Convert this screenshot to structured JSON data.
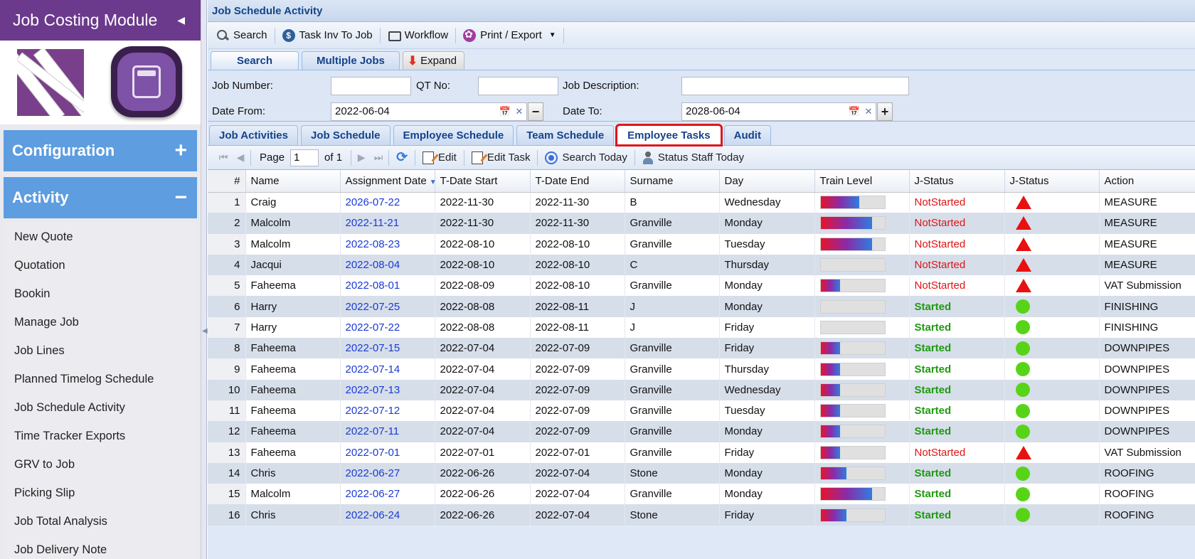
{
  "sidebar": {
    "title": "Job Costing Module",
    "sections": [
      {
        "label": "Configuration",
        "sign": "+"
      },
      {
        "label": "Activity",
        "sign": "−"
      }
    ],
    "menu": [
      "New Quote",
      "Quotation",
      "Bookin",
      "Manage Job",
      "Job Lines",
      "Planned Timelog Schedule",
      "Job Schedule Activity",
      "Time Tracker Exports",
      "GRV to Job",
      "Picking Slip",
      "Job Total Analysis",
      "Job Delivery Note"
    ]
  },
  "panel_title": "Job Schedule Activity",
  "toolbar": {
    "search": "Search",
    "task_inv": "Task Inv To Job",
    "workflow": "Workflow",
    "print_export": "Print / Export"
  },
  "search_tabs": {
    "search": "Search",
    "multiple": "Multiple Jobs",
    "expand": "Expand"
  },
  "form": {
    "job_number_label": "Job Number:",
    "qt_no_label": "QT No:",
    "job_desc_label": "Job Description:",
    "date_from_label": "Date From:",
    "date_from": "2022-06-04",
    "date_to_label": "Date To:",
    "date_to": "2028-06-04"
  },
  "tabs": [
    "Job Activities",
    "Job Schedule",
    "Employee Schedule",
    "Team Schedule",
    "Employee Tasks",
    "Audit"
  ],
  "active_tab": "Employee Tasks",
  "pager": {
    "page_label": "Page",
    "page": "1",
    "of": "of 1",
    "edit": "Edit",
    "edit_task": "Edit Task",
    "search_today": "Search Today",
    "status_staff": "Status Staff Today"
  },
  "columns": [
    "#",
    "Name",
    "Assignment Date",
    "T-Date Start",
    "T-Date End",
    "Surname",
    "Day",
    "Train Level",
    "J-Status",
    "J-Status",
    "Action"
  ],
  "colors": {
    "not_started": "#e01414",
    "started": "#1e9a10",
    "accent": "#15428b"
  },
  "rows": [
    {
      "n": "1",
      "name": "Craig",
      "assign": "2026-07-22",
      "start": "2022-11-30",
      "end": "2022-11-30",
      "surname": "B",
      "day": "Wednesday",
      "train": 0.6,
      "status": "NotStarted",
      "action": "MEASURE"
    },
    {
      "n": "2",
      "name": "Malcolm",
      "assign": "2022-11-21",
      "start": "2022-11-30",
      "end": "2022-11-30",
      "surname": "Granville",
      "day": "Monday",
      "train": 0.8,
      "status": "NotStarted",
      "action": "MEASURE"
    },
    {
      "n": "3",
      "name": "Malcolm",
      "assign": "2022-08-23",
      "start": "2022-08-10",
      "end": "2022-08-10",
      "surname": "Granville",
      "day": "Tuesday",
      "train": 0.8,
      "status": "NotStarted",
      "action": "MEASURE"
    },
    {
      "n": "4",
      "name": "Jacqui",
      "assign": "2022-08-04",
      "start": "2022-08-10",
      "end": "2022-08-10",
      "surname": "C",
      "day": "Thursday",
      "train": 0,
      "status": "NotStarted",
      "action": "MEASURE"
    },
    {
      "n": "5",
      "name": "Faheema",
      "assign": "2022-08-01",
      "start": "2022-08-09",
      "end": "2022-08-10",
      "surname": "Granville",
      "day": "Monday",
      "train": 0.3,
      "status": "NotStarted",
      "action": "VAT Submission"
    },
    {
      "n": "6",
      "name": "Harry",
      "assign": "2022-07-25",
      "start": "2022-08-08",
      "end": "2022-08-11",
      "surname": "J",
      "day": "Monday",
      "train": 0,
      "status": "Started",
      "action": "FINISHING"
    },
    {
      "n": "7",
      "name": "Harry",
      "assign": "2022-07-22",
      "start": "2022-08-08",
      "end": "2022-08-11",
      "surname": "J",
      "day": "Friday",
      "train": 0,
      "status": "Started",
      "action": "FINISHING"
    },
    {
      "n": "8",
      "name": "Faheema",
      "assign": "2022-07-15",
      "start": "2022-07-04",
      "end": "2022-07-09",
      "surname": "Granville",
      "day": "Friday",
      "train": 0.3,
      "status": "Started",
      "action": "DOWNPIPES"
    },
    {
      "n": "9",
      "name": "Faheema",
      "assign": "2022-07-14",
      "start": "2022-07-04",
      "end": "2022-07-09",
      "surname": "Granville",
      "day": "Thursday",
      "train": 0.3,
      "status": "Started",
      "action": "DOWNPIPES"
    },
    {
      "n": "10",
      "name": "Faheema",
      "assign": "2022-07-13",
      "start": "2022-07-04",
      "end": "2022-07-09",
      "surname": "Granville",
      "day": "Wednesday",
      "train": 0.3,
      "status": "Started",
      "action": "DOWNPIPES"
    },
    {
      "n": "11",
      "name": "Faheema",
      "assign": "2022-07-12",
      "start": "2022-07-04",
      "end": "2022-07-09",
      "surname": "Granville",
      "day": "Tuesday",
      "train": 0.3,
      "status": "Started",
      "action": "DOWNPIPES"
    },
    {
      "n": "12",
      "name": "Faheema",
      "assign": "2022-07-11",
      "start": "2022-07-04",
      "end": "2022-07-09",
      "surname": "Granville",
      "day": "Monday",
      "train": 0.3,
      "status": "Started",
      "action": "DOWNPIPES"
    },
    {
      "n": "13",
      "name": "Faheema",
      "assign": "2022-07-01",
      "start": "2022-07-01",
      "end": "2022-07-01",
      "surname": "Granville",
      "day": "Friday",
      "train": 0.3,
      "status": "NotStarted",
      "action": "VAT Submission"
    },
    {
      "n": "14",
      "name": "Chris",
      "assign": "2022-06-27",
      "start": "2022-06-26",
      "end": "2022-07-04",
      "surname": "Stone",
      "day": "Monday",
      "train": 0.4,
      "status": "Started",
      "action": "ROOFING"
    },
    {
      "n": "15",
      "name": "Malcolm",
      "assign": "2022-06-27",
      "start": "2022-06-26",
      "end": "2022-07-04",
      "surname": "Granville",
      "day": "Monday",
      "train": 0.8,
      "status": "Started",
      "action": "ROOFING"
    },
    {
      "n": "16",
      "name": "Chris",
      "assign": "2022-06-24",
      "start": "2022-06-26",
      "end": "2022-07-04",
      "surname": "Stone",
      "day": "Friday",
      "train": 0.4,
      "status": "Started",
      "action": "ROOFING"
    }
  ]
}
